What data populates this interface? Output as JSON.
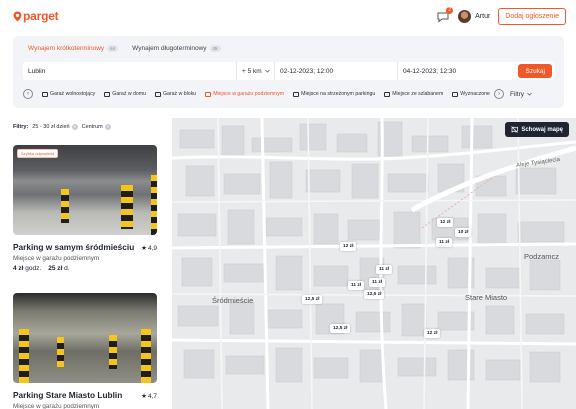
{
  "header": {
    "logo": "parget",
    "messages_count": "2",
    "user_name": "Artur",
    "add_button": "Dodaj ogłoszenie"
  },
  "search": {
    "tabs": [
      {
        "label": "Wynajem krótkoterminowy",
        "count": "64"
      },
      {
        "label": "Wynajem długoterminowy",
        "count": "45"
      }
    ],
    "city": "Lublin",
    "radius": "+ 5 km",
    "date_from": "02-12-2023; 12:00",
    "date_to": "04-12-2023; 12:30",
    "search_button": "Szukaj"
  },
  "categories": [
    "Garaż wolnostojący",
    "Garaż w domu",
    "Garaż w bloku",
    "Miejsce w garażu podziemnym",
    "Miejsce na strzeżonym parkingu",
    "Miejsce ze szlabanem",
    "Wyznaczone"
  ],
  "filters_button": "Filtry",
  "active_filters": {
    "label": "Filtry:",
    "chips": [
      "25 - 30 zł dzień",
      "Centrum"
    ]
  },
  "listings": [
    {
      "badge": "Szybka odpowiedź",
      "title": "Parking w samym śródmieściu",
      "rating": "4,9",
      "type": "Miejsce w garażu podziemnym",
      "price_hour": "4 zł",
      "price_hour_unit": "godz.",
      "price_day": "25 zł",
      "price_day_unit": "d."
    },
    {
      "title": "Parking Stare Miasto Lublin",
      "rating": "4,7",
      "type": "Miejsce w garażu podziemnym"
    }
  ],
  "map": {
    "hide_button": "Schowaj mapę",
    "labels": {
      "srodmiescie": "Śródmieście",
      "stare_miasto": "Stare Miasto",
      "podzamcze": "Podzamcz",
      "street": "Aleje Tysiąclecia"
    },
    "markers": [
      "12 zł",
      "10 zł",
      "11 zł",
      "12 zł",
      "11 zł",
      "11 zł",
      "11 zł",
      "12,5 zł",
      "12,5 zł",
      "12,5 zł",
      "12 zł"
    ]
  },
  "colors": {
    "accent": "#f0582a",
    "dark": "#1f2430"
  }
}
